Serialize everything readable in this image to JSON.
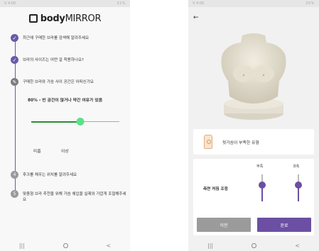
{
  "left": {
    "status_time": "V 4:00",
    "status_right": "31%",
    "brand": {
      "bold": "body",
      "normal": "MIRROR"
    },
    "steps": [
      {
        "text": "최근에 구매한 브라를 검색해 알려주세요"
      },
      {
        "text": "브라의 사이즈는 어떤 걸 착용하나요?"
      },
      {
        "text": "구매한 브라와 가슴 사이 공간은 어떠신가요"
      },
      {
        "num": "4",
        "text": "후크를 채우는 위치를 알려주세요"
      },
      {
        "num": "5",
        "text": "맞춤형 브라 추천을 위해 가슴 쉐입을 실제와 가깝게 조절해주세요"
      }
    ],
    "percent_text": "80% - 빈 공간이 많거나 약간 여유가 있음",
    "slider_value_pct": 56,
    "labels": [
      "미흡",
      "이상"
    ]
  },
  "right": {
    "status_time": "V 4:00",
    "status_right": "20%",
    "shape_card_text": "윗가슴이 부족한 유형",
    "caps": [
      "부족",
      "과측"
    ],
    "adjust_label": "측면 처짐 조정",
    "vslider_values": [
      0.6,
      0.6
    ],
    "btn_prev": "이전",
    "btn_done": "완료",
    "accent": "#6b4fa3"
  },
  "nav": {
    "recent": "|||",
    "back": "<"
  }
}
